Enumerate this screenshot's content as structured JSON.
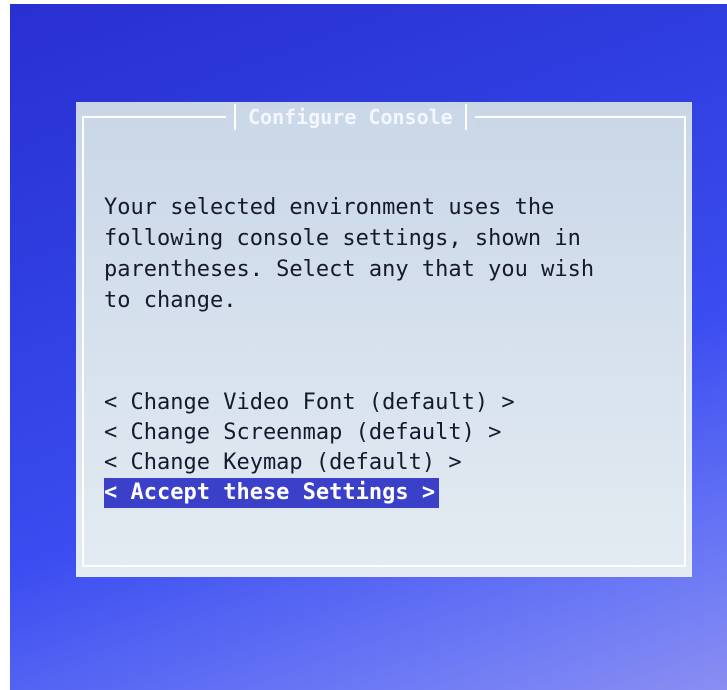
{
  "dialog": {
    "title": "Configure Console",
    "message_lines": [
      "Your selected environment uses the",
      "following console settings, shown in",
      "parentheses. Select any that you wish",
      "to change."
    ],
    "menu": [
      {
        "label": "< Change Video Font (default) >"
      },
      {
        "label": "< Change Screenmap (default) >"
      },
      {
        "label": "< Change Keymap (default) >"
      },
      {
        "label": "< Accept these Settings >"
      }
    ]
  },
  "colors": {
    "background": "#2f3ee0",
    "dialog": "#d3dfec",
    "highlight": "#3a40c8"
  }
}
